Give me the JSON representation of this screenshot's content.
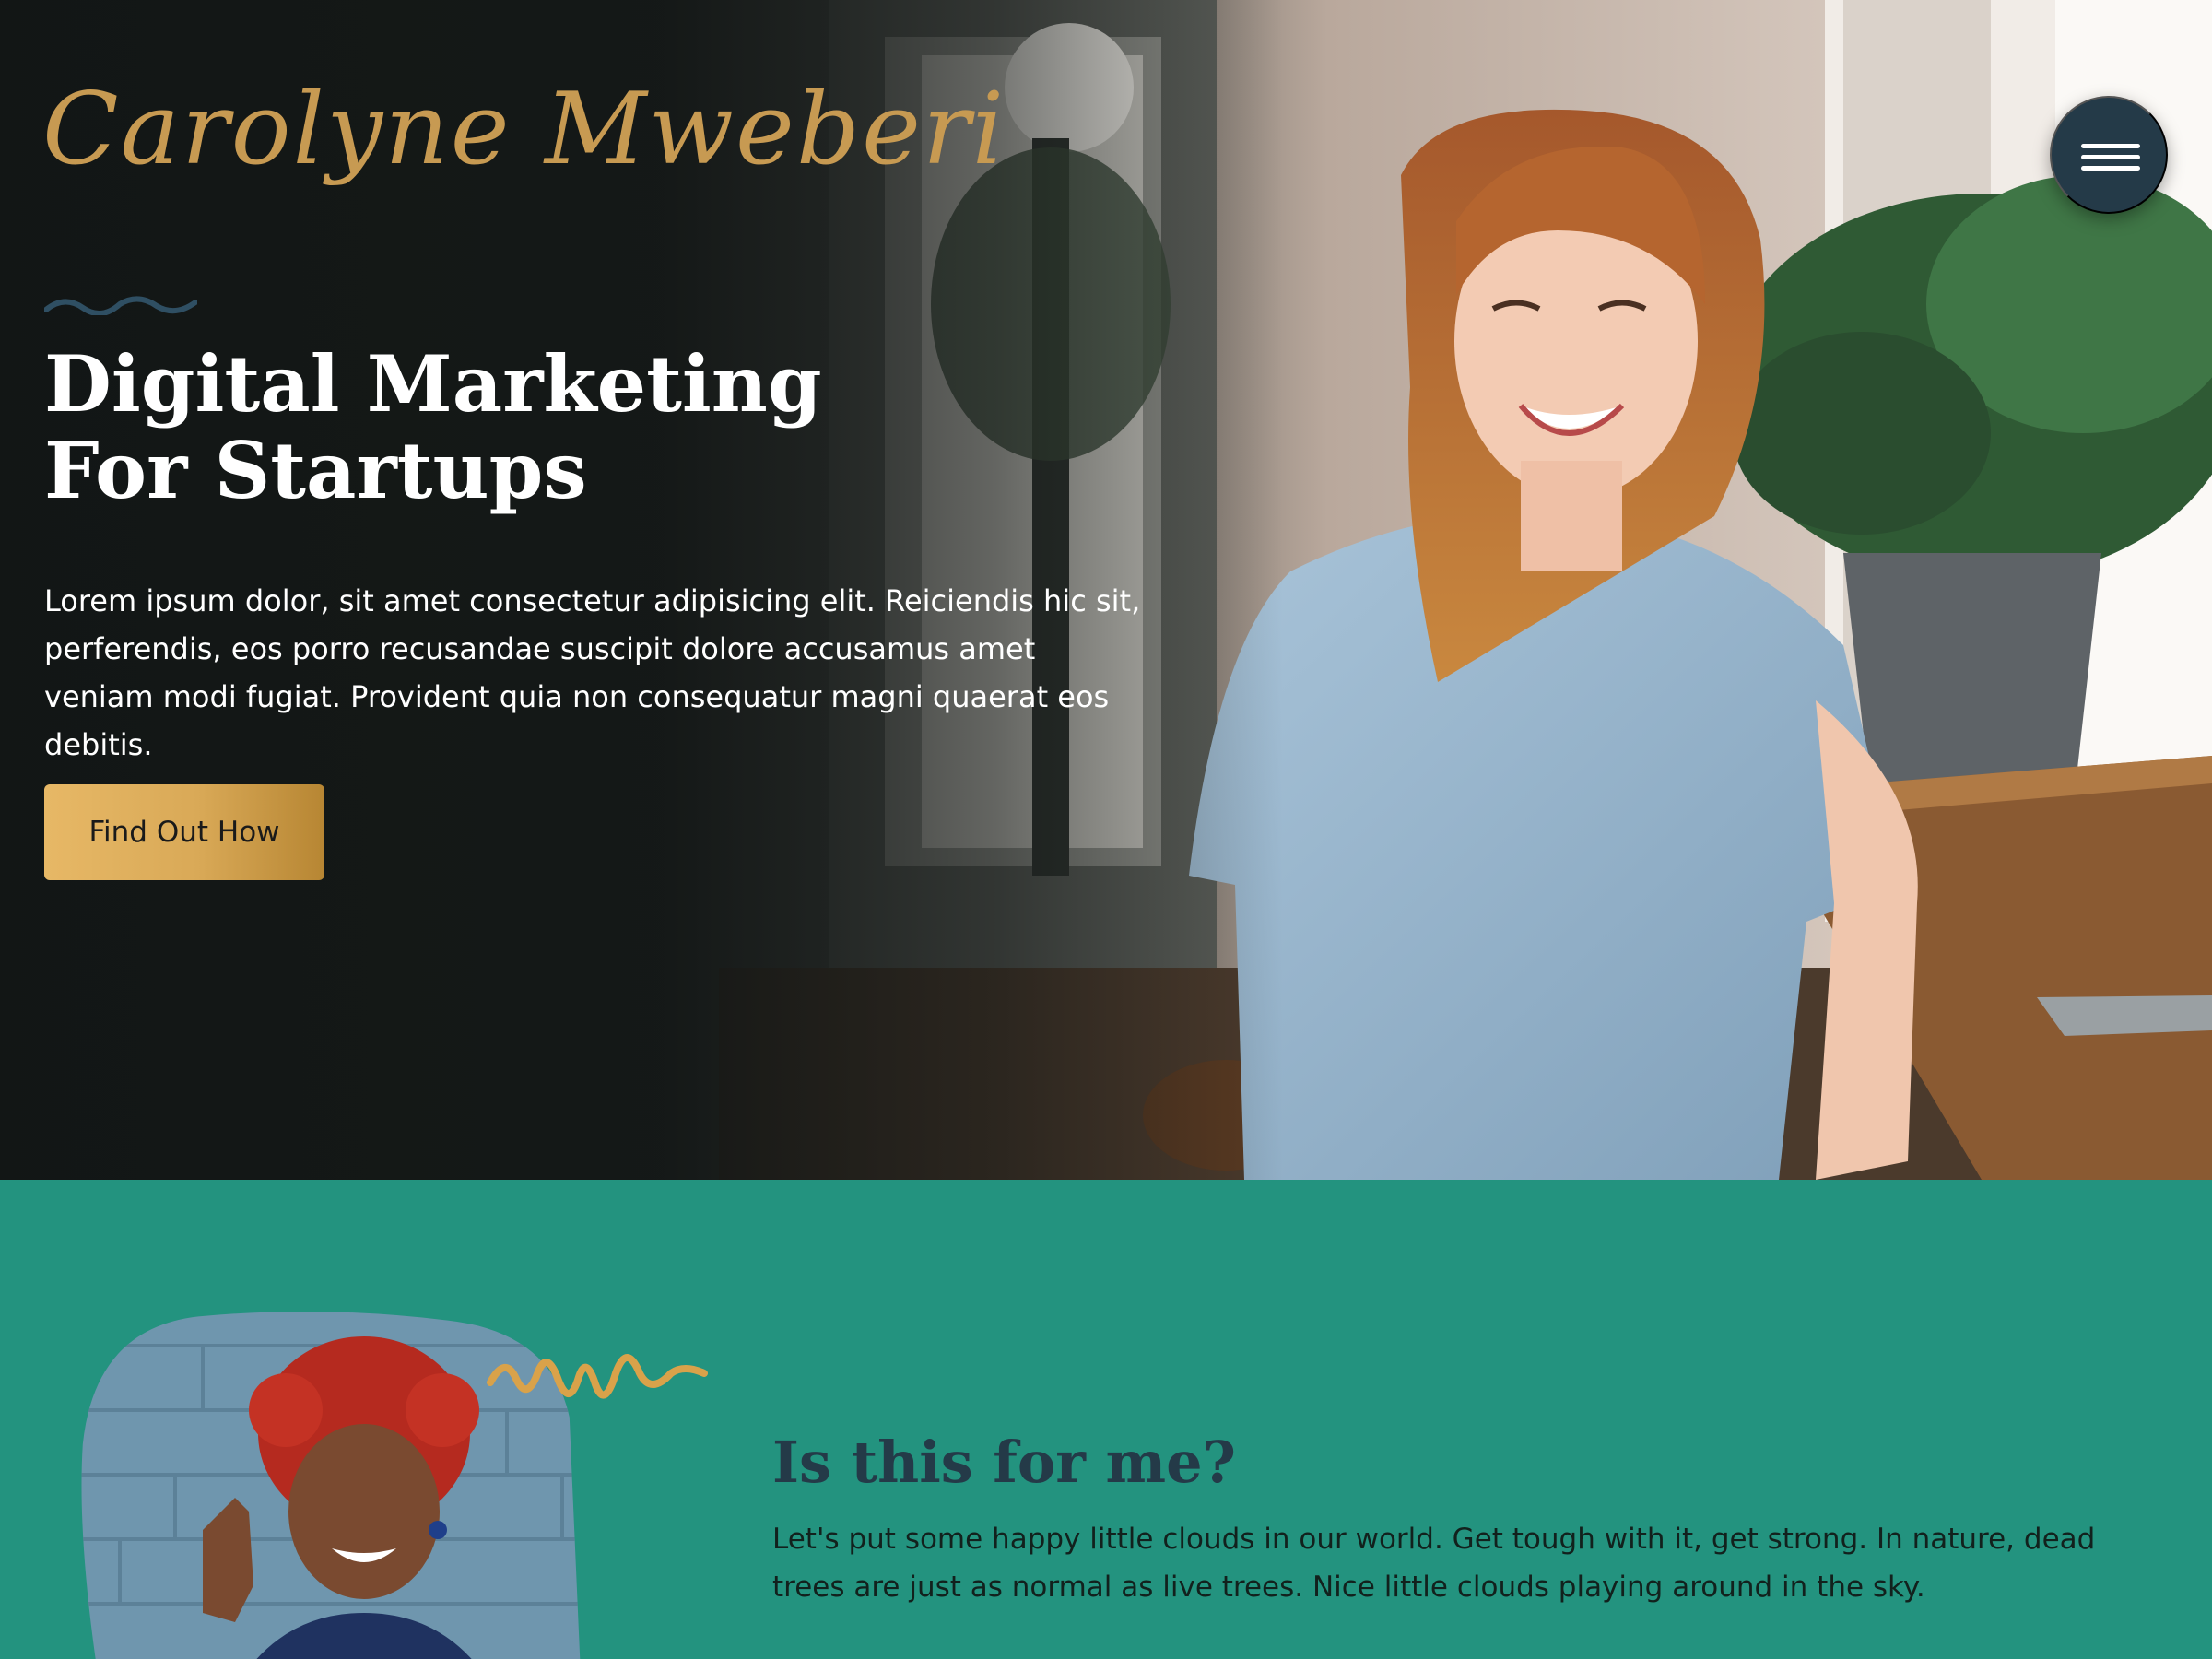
{
  "brand": {
    "name": "Carolyne Mweberi"
  },
  "nav": {
    "menu_icon": "hamburger-icon"
  },
  "hero": {
    "headline_line1": "Digital Marketing",
    "headline_line2": "For Startups",
    "lead": "Lorem ipsum dolor, sit amet consectetur adipisicing elit. Reiciendis hic sit, perferendis, eos porro recusandae suscipit dolore accusamus amet veniam modi fugiat. Provident quia non consequatur magni quaerat eos debitis.",
    "cta_label": "Find Out How"
  },
  "about": {
    "title": "Is this for me?",
    "text": "Let's put some happy little clouds in our world. Get tough with it, get strong. In nature, dead trees are just as normal as live trees. Nice little clouds playing around in the sky."
  },
  "colors": {
    "hero_dark": "#141716",
    "gold": "#c79a52",
    "navy": "#243a48",
    "teal": "#23937f",
    "button_gold": "#e7b866"
  }
}
